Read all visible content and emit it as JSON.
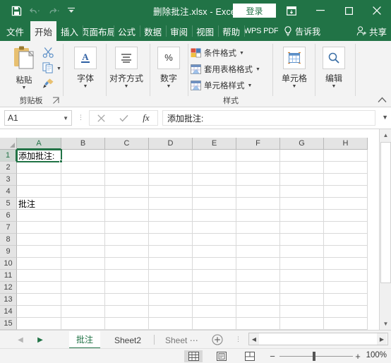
{
  "titlebar": {
    "document_title": "删除批注.xlsx  -  Excel",
    "signin_label": "登录",
    "qat": [
      {
        "name": "save-icon",
        "label": "保存"
      },
      {
        "name": "undo-icon",
        "label": "撤销"
      },
      {
        "name": "redo-icon",
        "label": "恢复"
      },
      {
        "name": "customize-qat-icon",
        "label": "自定义快速访问工具栏"
      }
    ],
    "window_controls": [
      {
        "name": "ribbon-display-options-icon",
        "label": "功能区显示选项"
      },
      {
        "name": "minimize-icon",
        "label": "最小化"
      },
      {
        "name": "maximize-icon",
        "label": "最大化"
      },
      {
        "name": "close-icon",
        "label": "关闭"
      }
    ]
  },
  "ribbon_tabs": [
    {
      "label": "文件",
      "active": false
    },
    {
      "label": "开始",
      "active": true
    },
    {
      "label": "插入",
      "active": false
    },
    {
      "label": "页面布局",
      "active": false
    },
    {
      "label": "公式",
      "active": false
    },
    {
      "label": "数据",
      "active": false
    },
    {
      "label": "审阅",
      "active": false
    },
    {
      "label": "视图",
      "active": false
    },
    {
      "label": "帮助",
      "active": false
    },
    {
      "label": "WPS PDF",
      "active": false
    }
  ],
  "tellme": {
    "label": "告诉我",
    "icon": "lightbulb-icon"
  },
  "share": {
    "label": "共享",
    "icon": "share-person-icon"
  },
  "ribbon": {
    "groups": [
      {
        "name": "clipboard",
        "label": "剪贴板",
        "paste_label": "粘贴",
        "items": [
          {
            "label": "剪切",
            "icon": "scissors-icon"
          },
          {
            "label": "复制",
            "icon": "copy-icon"
          },
          {
            "label": "格式刷",
            "icon": "format-painter-icon"
          }
        ]
      },
      {
        "name": "font",
        "label": "字体",
        "icon": "font-A-icon"
      },
      {
        "name": "alignment",
        "label": "对齐方式",
        "icon": "align-lines-icon"
      },
      {
        "name": "number",
        "label": "数字",
        "icon": "percent-icon"
      },
      {
        "name": "styles",
        "label": "样式",
        "items": [
          {
            "label": "条件格式",
            "icon": "conditional-formatting-icon"
          },
          {
            "label": "套用表格格式",
            "icon": "format-as-table-icon"
          },
          {
            "label": "单元格样式",
            "icon": "cell-styles-icon"
          }
        ]
      },
      {
        "name": "cells",
        "label": "单元格",
        "icon": "cells-grid-icon"
      },
      {
        "name": "editing",
        "label": "编辑",
        "icon": "magnifier-icon"
      }
    ]
  },
  "formula_bar": {
    "name_box_value": "A1",
    "cancel_icon": "cancel-x-icon",
    "enter_icon": "confirm-check-icon",
    "function_icon": "insert-function-fx-icon",
    "formula_value": "添加批注:",
    "expand_icon": "expand-formula-bar-icon"
  },
  "grid": {
    "columns": [
      "A",
      "B",
      "C",
      "D",
      "E",
      "F",
      "G",
      "H"
    ],
    "selected_column": "A",
    "rows": [
      "1",
      "2",
      "3",
      "4",
      "5",
      "6",
      "7",
      "8",
      "9",
      "10",
      "11",
      "12",
      "13",
      "14",
      "15"
    ],
    "selected_row": "1",
    "cells": [
      {
        "ref": "A1",
        "row": 1,
        "col": 0,
        "value": "添加批注:"
      },
      {
        "ref": "A5",
        "row": 5,
        "col": 0,
        "value": "批注"
      }
    ],
    "active_cell": "A1"
  },
  "sheet_tabs": {
    "prev_icon": "nav-prev-icon",
    "next_icon": "nav-next-icon",
    "tabs": [
      {
        "label": "批注",
        "active": true
      },
      {
        "label": "Sheet2",
        "active": false
      },
      {
        "label": "Sheet ⋯",
        "active": false
      }
    ],
    "add_sheet_icon": "add-sheet-plus-icon",
    "hscroll_left_icon": "hscroll-left-arrow-icon",
    "hscroll_right_icon": "hscroll-right-arrow-icon"
  },
  "status_bar": {
    "views": [
      {
        "name": "normal-view-icon",
        "label": "普通",
        "active": true
      },
      {
        "name": "page-layout-view-icon",
        "label": "页面布局",
        "active": false
      },
      {
        "name": "page-break-view-icon",
        "label": "分页预览",
        "active": false
      }
    ],
    "zoom_out_label": "−",
    "zoom_in_label": "+",
    "zoom_level": "100%"
  },
  "colors": {
    "excel_green": "#217346",
    "ribbon_bg": "#f3f3f3",
    "grid_line": "#d9d9d9",
    "header_bg": "#e4e4e4"
  }
}
